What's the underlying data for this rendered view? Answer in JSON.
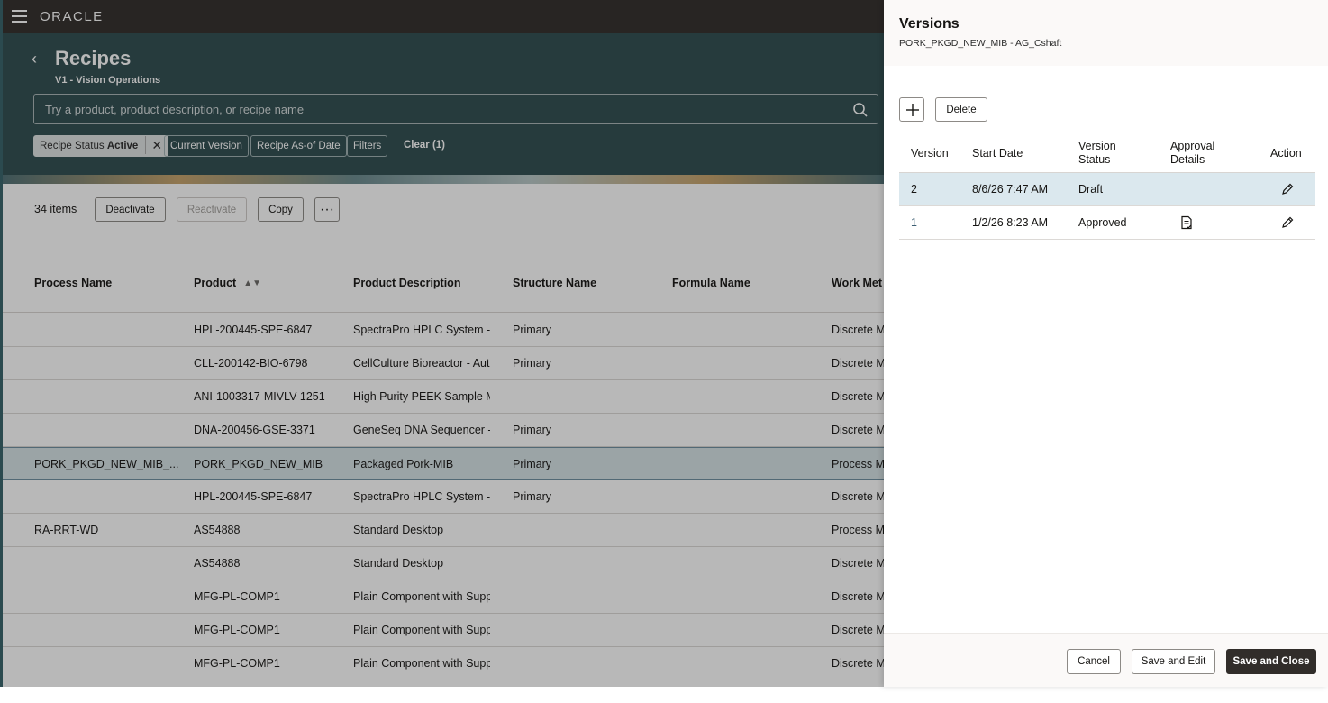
{
  "topbar": {
    "logo": "ORACLE"
  },
  "header": {
    "title": "Recipes",
    "subtitle": "V1 - Vision Operations",
    "search_placeholder": "Try a product, product description, or recipe name",
    "chips": {
      "status_label": "Recipe Status",
      "status_value": "Active",
      "current_version": "Current Version",
      "as_of_date": "Recipe As-of Date",
      "filters": "Filters",
      "clear": "Clear (1)"
    }
  },
  "toolbar": {
    "count": "34 items",
    "deactivate": "Deactivate",
    "reactivate": "Reactivate",
    "copy": "Copy",
    "more": "···"
  },
  "table": {
    "columns": [
      "Process Name",
      "Product",
      "Product Description",
      "Structure Name",
      "Formula Name",
      "Work Met"
    ],
    "rows": [
      [
        "",
        "HPL-200445-SPE-6847",
        "SpectraPro HPLC System - I",
        "Primary",
        "",
        "Discrete M"
      ],
      [
        "",
        "CLL-200142-BIO-6798",
        "CellCulture Bioreactor - Aut",
        "Primary",
        "",
        "Discrete M"
      ],
      [
        "",
        "ANI-1003317-MIVLV-1251",
        "High Purity PEEK Sample M",
        "",
        "",
        "Discrete M"
      ],
      [
        "",
        "DNA-200456-GSE-3371",
        "GeneSeq DNA Sequencer -",
        "Primary",
        "",
        "Discrete M"
      ],
      [
        "PORK_PKGD_NEW_MIB_...",
        "PORK_PKGD_NEW_MIB",
        "Packaged Pork-MIB",
        "Primary",
        "",
        "Process M"
      ],
      [
        "",
        "HPL-200445-SPE-6847",
        "SpectraPro HPLC System - I",
        "Primary",
        "",
        "Discrete M"
      ],
      [
        "RA-RRT-WD",
        "AS54888",
        "Standard Desktop",
        "",
        "",
        "Process M"
      ],
      [
        "",
        "AS54888",
        "Standard Desktop",
        "",
        "",
        "Discrete M"
      ],
      [
        "",
        "MFG-PL-COMP1",
        "Plain Component with Supp",
        "",
        "",
        "Discrete M"
      ],
      [
        "",
        "MFG-PL-COMP1",
        "Plain Component with Supp",
        "",
        "",
        "Discrete M"
      ],
      [
        "",
        "MFG-PL-COMP1",
        "Plain Component with Supp",
        "",
        "",
        "Discrete M"
      ]
    ],
    "selected_row": 4
  },
  "drawer": {
    "title": "Versions",
    "subtitle": "PORK_PKGD_NEW_MIB - AG_Cshaft",
    "delete": "Delete",
    "columns": {
      "version": "Version",
      "start_date": "Start Date",
      "status_line1": "Version",
      "status_line2": "Status",
      "approval_line1": "Approval",
      "approval_line2": "Details",
      "action": "Action"
    },
    "rows": [
      {
        "version": "2",
        "start_date": "8/6/26 7:47 AM",
        "status": "Draft",
        "has_approval": false
      },
      {
        "version": "1",
        "start_date": "1/2/26 8:23 AM",
        "status": "Approved",
        "has_approval": true
      }
    ],
    "footer": {
      "cancel": "Cancel",
      "save_edit": "Save and Edit",
      "save_close": "Save and Close"
    }
  }
}
